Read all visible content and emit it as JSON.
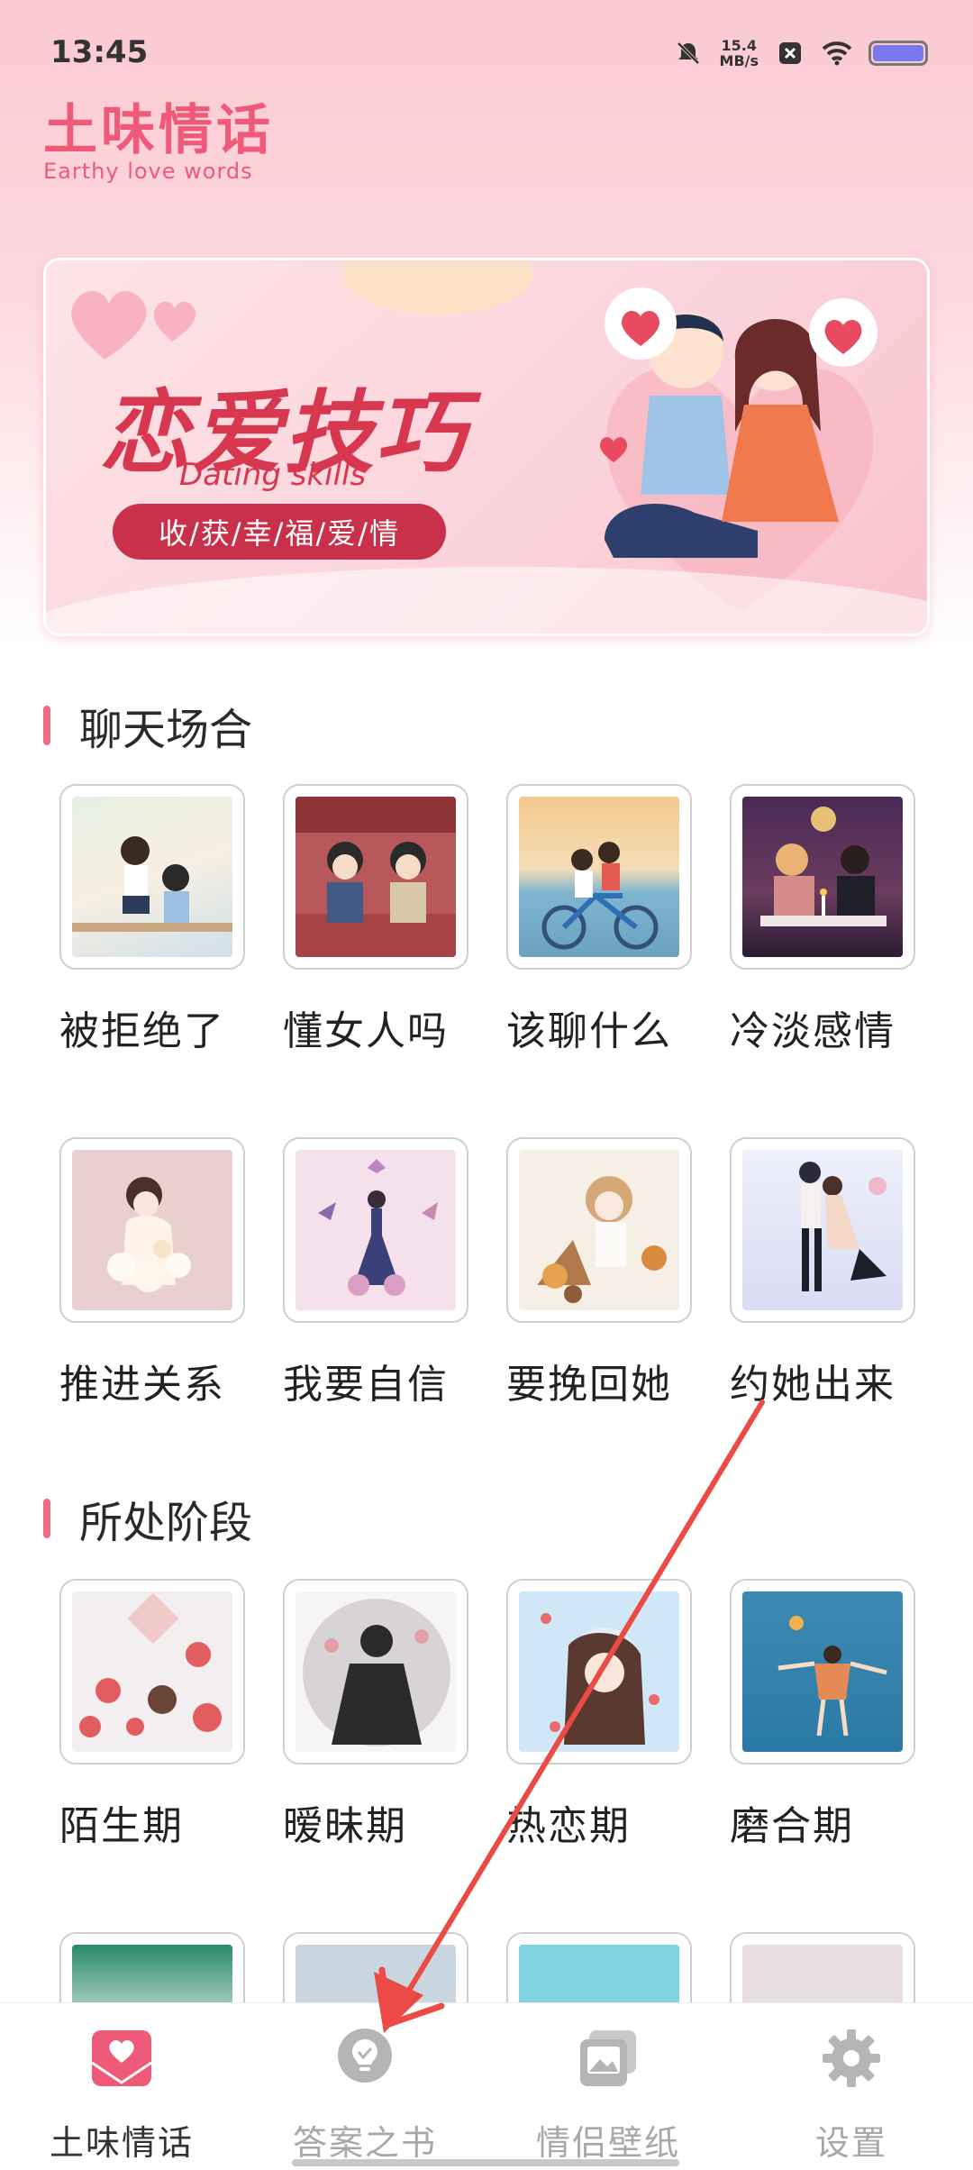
{
  "status_bar": {
    "time": "13:45",
    "net_speed_value": "15.4",
    "net_speed_unit": "MB/s",
    "icons": [
      "mute-bell-icon",
      "close-box-icon",
      "wifi-icon",
      "battery-icon"
    ]
  },
  "header": {
    "title": "土味情话",
    "subtitle": "Earthy love words"
  },
  "banner": {
    "title": "恋爱技巧",
    "subtitle": "Dating skills",
    "pill": "收/获/幸/福/爱/情"
  },
  "sections": [
    {
      "title": "聊天场合",
      "items": [
        {
          "label": "被拒绝了"
        },
        {
          "label": "懂女人吗"
        },
        {
          "label": "该聊什么"
        },
        {
          "label": "冷淡感情"
        },
        {
          "label": "推进关系"
        },
        {
          "label": "我要自信"
        },
        {
          "label": "要挽回她"
        },
        {
          "label": "约她出来"
        }
      ]
    },
    {
      "title": "所处阶段",
      "items": [
        {
          "label": "陌生期"
        },
        {
          "label": "暧昧期"
        },
        {
          "label": "热恋期"
        },
        {
          "label": "磨合期"
        }
      ]
    }
  ],
  "bottom_nav": {
    "items": [
      {
        "label": "土味情话",
        "icon": "heart-envelope-icon",
        "active": true
      },
      {
        "label": "答案之书",
        "icon": "lightbulb-icon",
        "active": false
      },
      {
        "label": "情侣壁纸",
        "icon": "gallery-icon",
        "active": false
      },
      {
        "label": "设置",
        "icon": "gear-icon",
        "active": false
      }
    ]
  },
  "colors": {
    "accent": "#ee5a78",
    "banner_red": "#d8384f",
    "annotation_arrow": "#ec4a45",
    "nav_inactive": "#a8a8a8"
  }
}
